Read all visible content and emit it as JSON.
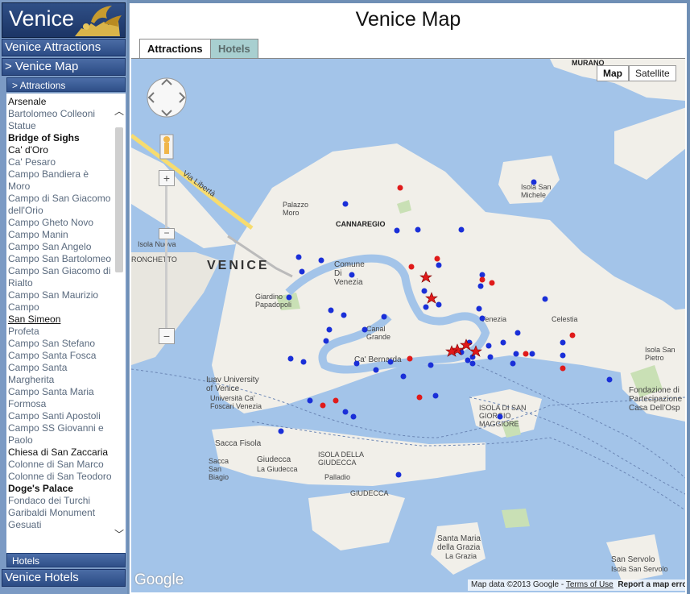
{
  "logo": {
    "text": "Venice"
  },
  "sidebar": {
    "venice_attractions": "Venice Attractions",
    "venice_map": "> Venice Map",
    "attractions_sub": "> Attractions",
    "hotels_sub": "Hotels",
    "venice_hotels": "Venice Hotels",
    "items": [
      {
        "label": "Arsenale",
        "style": "blk"
      },
      {
        "label": "Bartolomeo Colleoni Statue",
        "style": ""
      },
      {
        "label": "Bridge of Sighs",
        "style": "bold"
      },
      {
        "label": "Ca' d'Oro",
        "style": "blk"
      },
      {
        "label": "Ca' Pesaro",
        "style": ""
      },
      {
        "label": "Campo Bandiera è Moro",
        "style": ""
      },
      {
        "label": "Campo di San Giacomo dell'Orio",
        "style": ""
      },
      {
        "label": "Campo Gheto Novo",
        "style": ""
      },
      {
        "label": "Campo Manin",
        "style": ""
      },
      {
        "label": "Campo San Angelo",
        "style": ""
      },
      {
        "label": "Campo San Bartolomeo",
        "style": ""
      },
      {
        "label": "Campo San Giacomo di Rialto",
        "style": ""
      },
      {
        "label": "Campo San Maurizio Campo",
        "style": ""
      },
      {
        "label": "San Simeon",
        "style": "ul"
      },
      {
        "label": "Profeta",
        "style": ""
      },
      {
        "label": "Campo San Stefano",
        "style": ""
      },
      {
        "label": "Campo Santa Fosca",
        "style": ""
      },
      {
        "label": "Campo Santa Margherita",
        "style": ""
      },
      {
        "label": "Campo Santa Maria Formosa",
        "style": ""
      },
      {
        "label": "Campo Santi Apostoli",
        "style": ""
      },
      {
        "label": "Campo SS Giovanni e Paolo",
        "style": ""
      },
      {
        "label": "Chiesa di San Zaccaria",
        "style": "blk"
      },
      {
        "label": "Colonne di San Marco",
        "style": ""
      },
      {
        "label": "Colonne di San Teodoro",
        "style": ""
      },
      {
        "label": "Doge's Palace",
        "style": "bold"
      },
      {
        "label": "Fondaco dei Turchi",
        "style": ""
      },
      {
        "label": "Garibaldi Monument",
        "style": ""
      },
      {
        "label": "Gesuati",
        "style": ""
      }
    ]
  },
  "main": {
    "title": "Venice Map",
    "tabs": [
      {
        "label": "Attractions"
      },
      {
        "label": "Hotels"
      }
    ]
  },
  "map": {
    "map_button": "Map",
    "satellite_button": "Satellite",
    "google": "Google",
    "data": "Map data ©2013 Google",
    "terms": "Terms of Use",
    "report": "Report a map error",
    "labels": {
      "venice": "VENICE",
      "murano": "MURANO",
      "cannaregio": "CANNAREGIO",
      "palazzo_moro": "Palazzo Moro",
      "isola_san_michele": "Isola San Michele",
      "isola_nuova": "Isola Nuova",
      "tronchetto": "RONCHETTO",
      "comune": "Comune Di Venezia",
      "giardino": "Giardino Papadopoli",
      "venezia": "Venezia",
      "celestia": "Celestia",
      "canal_grande": "Canal Grande",
      "ca_bernarda": "Ca' Bernarda",
      "iuav": "Iuav University of Venice",
      "ca_foscari": "Università Ca' Foscari Venezia",
      "isola_san_pietro": "Isola San Pietro",
      "fondazione": "Fondazione di Partecipazione Casa Dell'Osp",
      "isola_san_giorgio": "ISOLA DI SAN GIORGIO MAGGIORE",
      "sacca_fisola": "Sacca Fisola",
      "sacca_san_biagio": "Sacca San Biagio",
      "giudecca": "Giudecca",
      "la_giudecca": "La Giudecca",
      "isola_giudecca": "ISOLA DELLA GIUDECCA",
      "palladio": "Palladio",
      "giudecca2": "GIUDECCA",
      "santa_maria": "Santa Maria della Grazia",
      "la_grazia": "La Grazia",
      "san_servolo": "San Servolo",
      "isola_san_servolo": "Isola San Servolo",
      "via_liberta": "Via Libertà"
    }
  },
  "colors": {
    "water": "#a3c4e9",
    "land": "#f1efe9",
    "accent": "#2b4b84",
    "marker_blue": "#1a2fd8",
    "marker_red": "#e01a1a"
  }
}
